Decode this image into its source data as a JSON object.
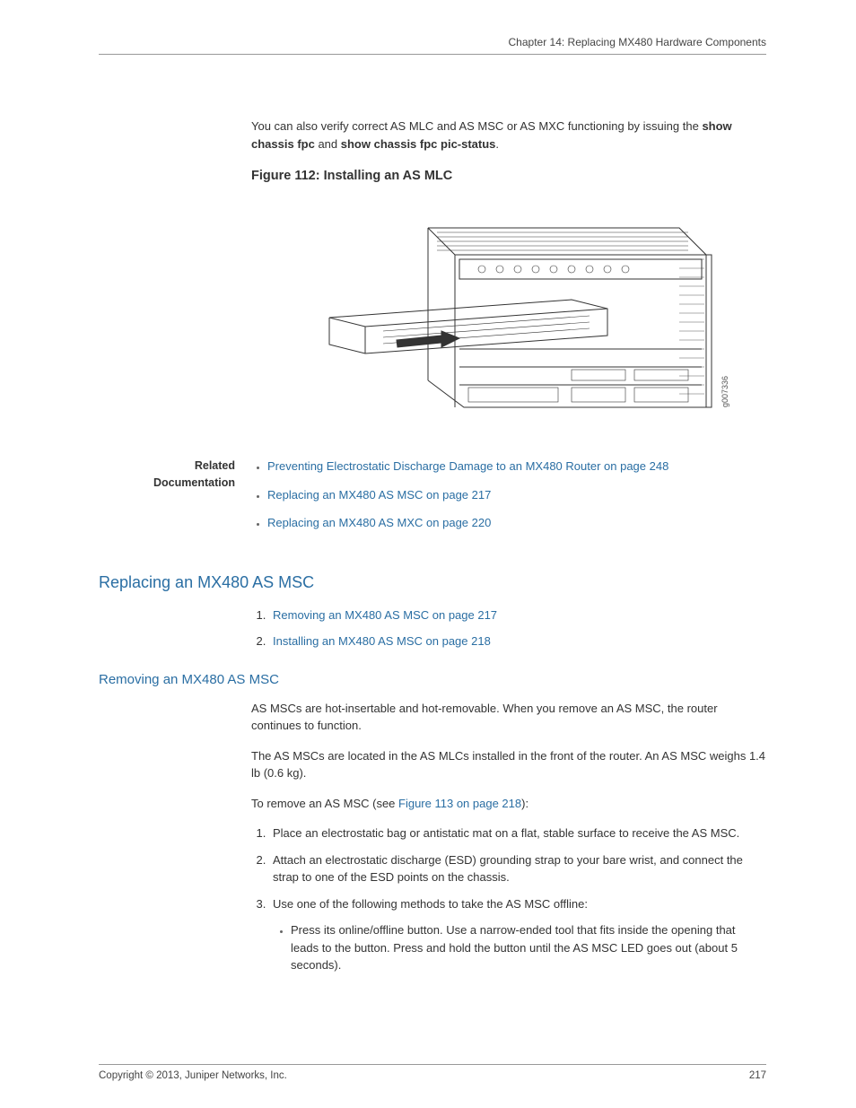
{
  "header": {
    "chapter": "Chapter 14: Replacing MX480 Hardware Components"
  },
  "intro": {
    "pre": "You can also verify correct AS MLC and AS MSC or AS MXC functioning by issuing the ",
    "cmd1": "show chassis fpc",
    "mid": " and ",
    "cmd2": "show chassis fpc pic-status",
    "post": "."
  },
  "figure": {
    "caption": "Figure 112: Installing an AS MLC",
    "gnum": "g007336"
  },
  "related": {
    "label1": "Related",
    "label2": "Documentation",
    "items": [
      "Preventing Electrostatic Discharge Damage to an MX480 Router on page 248",
      "Replacing an MX480 AS MSC on page 217",
      "Replacing an MX480 AS MXC on page 220"
    ]
  },
  "section": {
    "title": "Replacing an MX480 AS MSC",
    "toc": [
      {
        "num": "1.",
        "text": "Removing an MX480 AS MSC on page 217"
      },
      {
        "num": "2.",
        "text": "Installing an MX480 AS MSC on page 218"
      }
    ]
  },
  "subsection": {
    "title": "Removing an MX480 AS MSC",
    "p1": "AS MSCs are hot-insertable and hot-removable. When you remove an AS MSC, the router continues to function.",
    "p2": "The AS MSCs are located in the AS MLCs installed in the front of the router. An AS MSC weighs 1.4 lb (0.6 kg).",
    "p3_pre": "To remove an AS MSC (see ",
    "p3_link": "Figure 113 on page 218",
    "p3_post": "):",
    "steps": [
      "Place an electrostatic bag or antistatic mat on a flat, stable surface to receive the AS MSC.",
      "Attach an electrostatic discharge (ESD) grounding strap to your bare wrist, and connect the strap to one of the ESD points on the chassis.",
      "Use one of the following methods to take the AS MSC offline:"
    ],
    "substeps": [
      "Press its online/offline button. Use a narrow-ended tool that fits inside the opening that leads to the button. Press and hold the button until the AS MSC LED goes out (about 5 seconds)."
    ]
  },
  "footer": {
    "copyright": "Copyright © 2013, Juniper Networks, Inc.",
    "pagenum": "217"
  }
}
